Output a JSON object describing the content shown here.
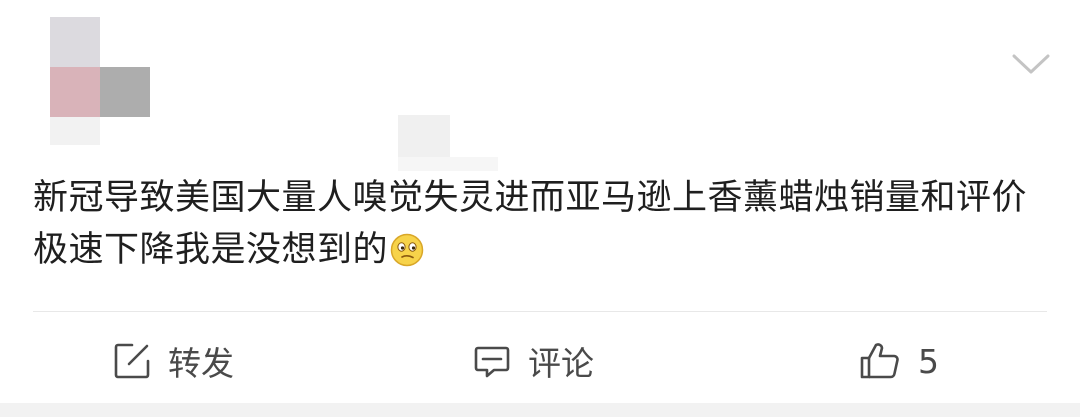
{
  "post": {
    "text": "新冠导致美国大量人嗅觉失灵进而亚马逊上香薰蜡烛销量和评价极速下降我是没想到的",
    "emoji": "thinking-face-emoji"
  },
  "header": {
    "menu_icon": "chevron-down-icon"
  },
  "actions": {
    "repost_label": "转发",
    "comment_label": "评论",
    "like_count": "5",
    "repost_icon": "repost-icon",
    "comment_icon": "comment-icon",
    "like_icon": "thumbs-up-icon"
  },
  "colors": {
    "text": "#1f1f1f",
    "action_text": "#4a4a4a",
    "divider": "#e8e8e8"
  }
}
